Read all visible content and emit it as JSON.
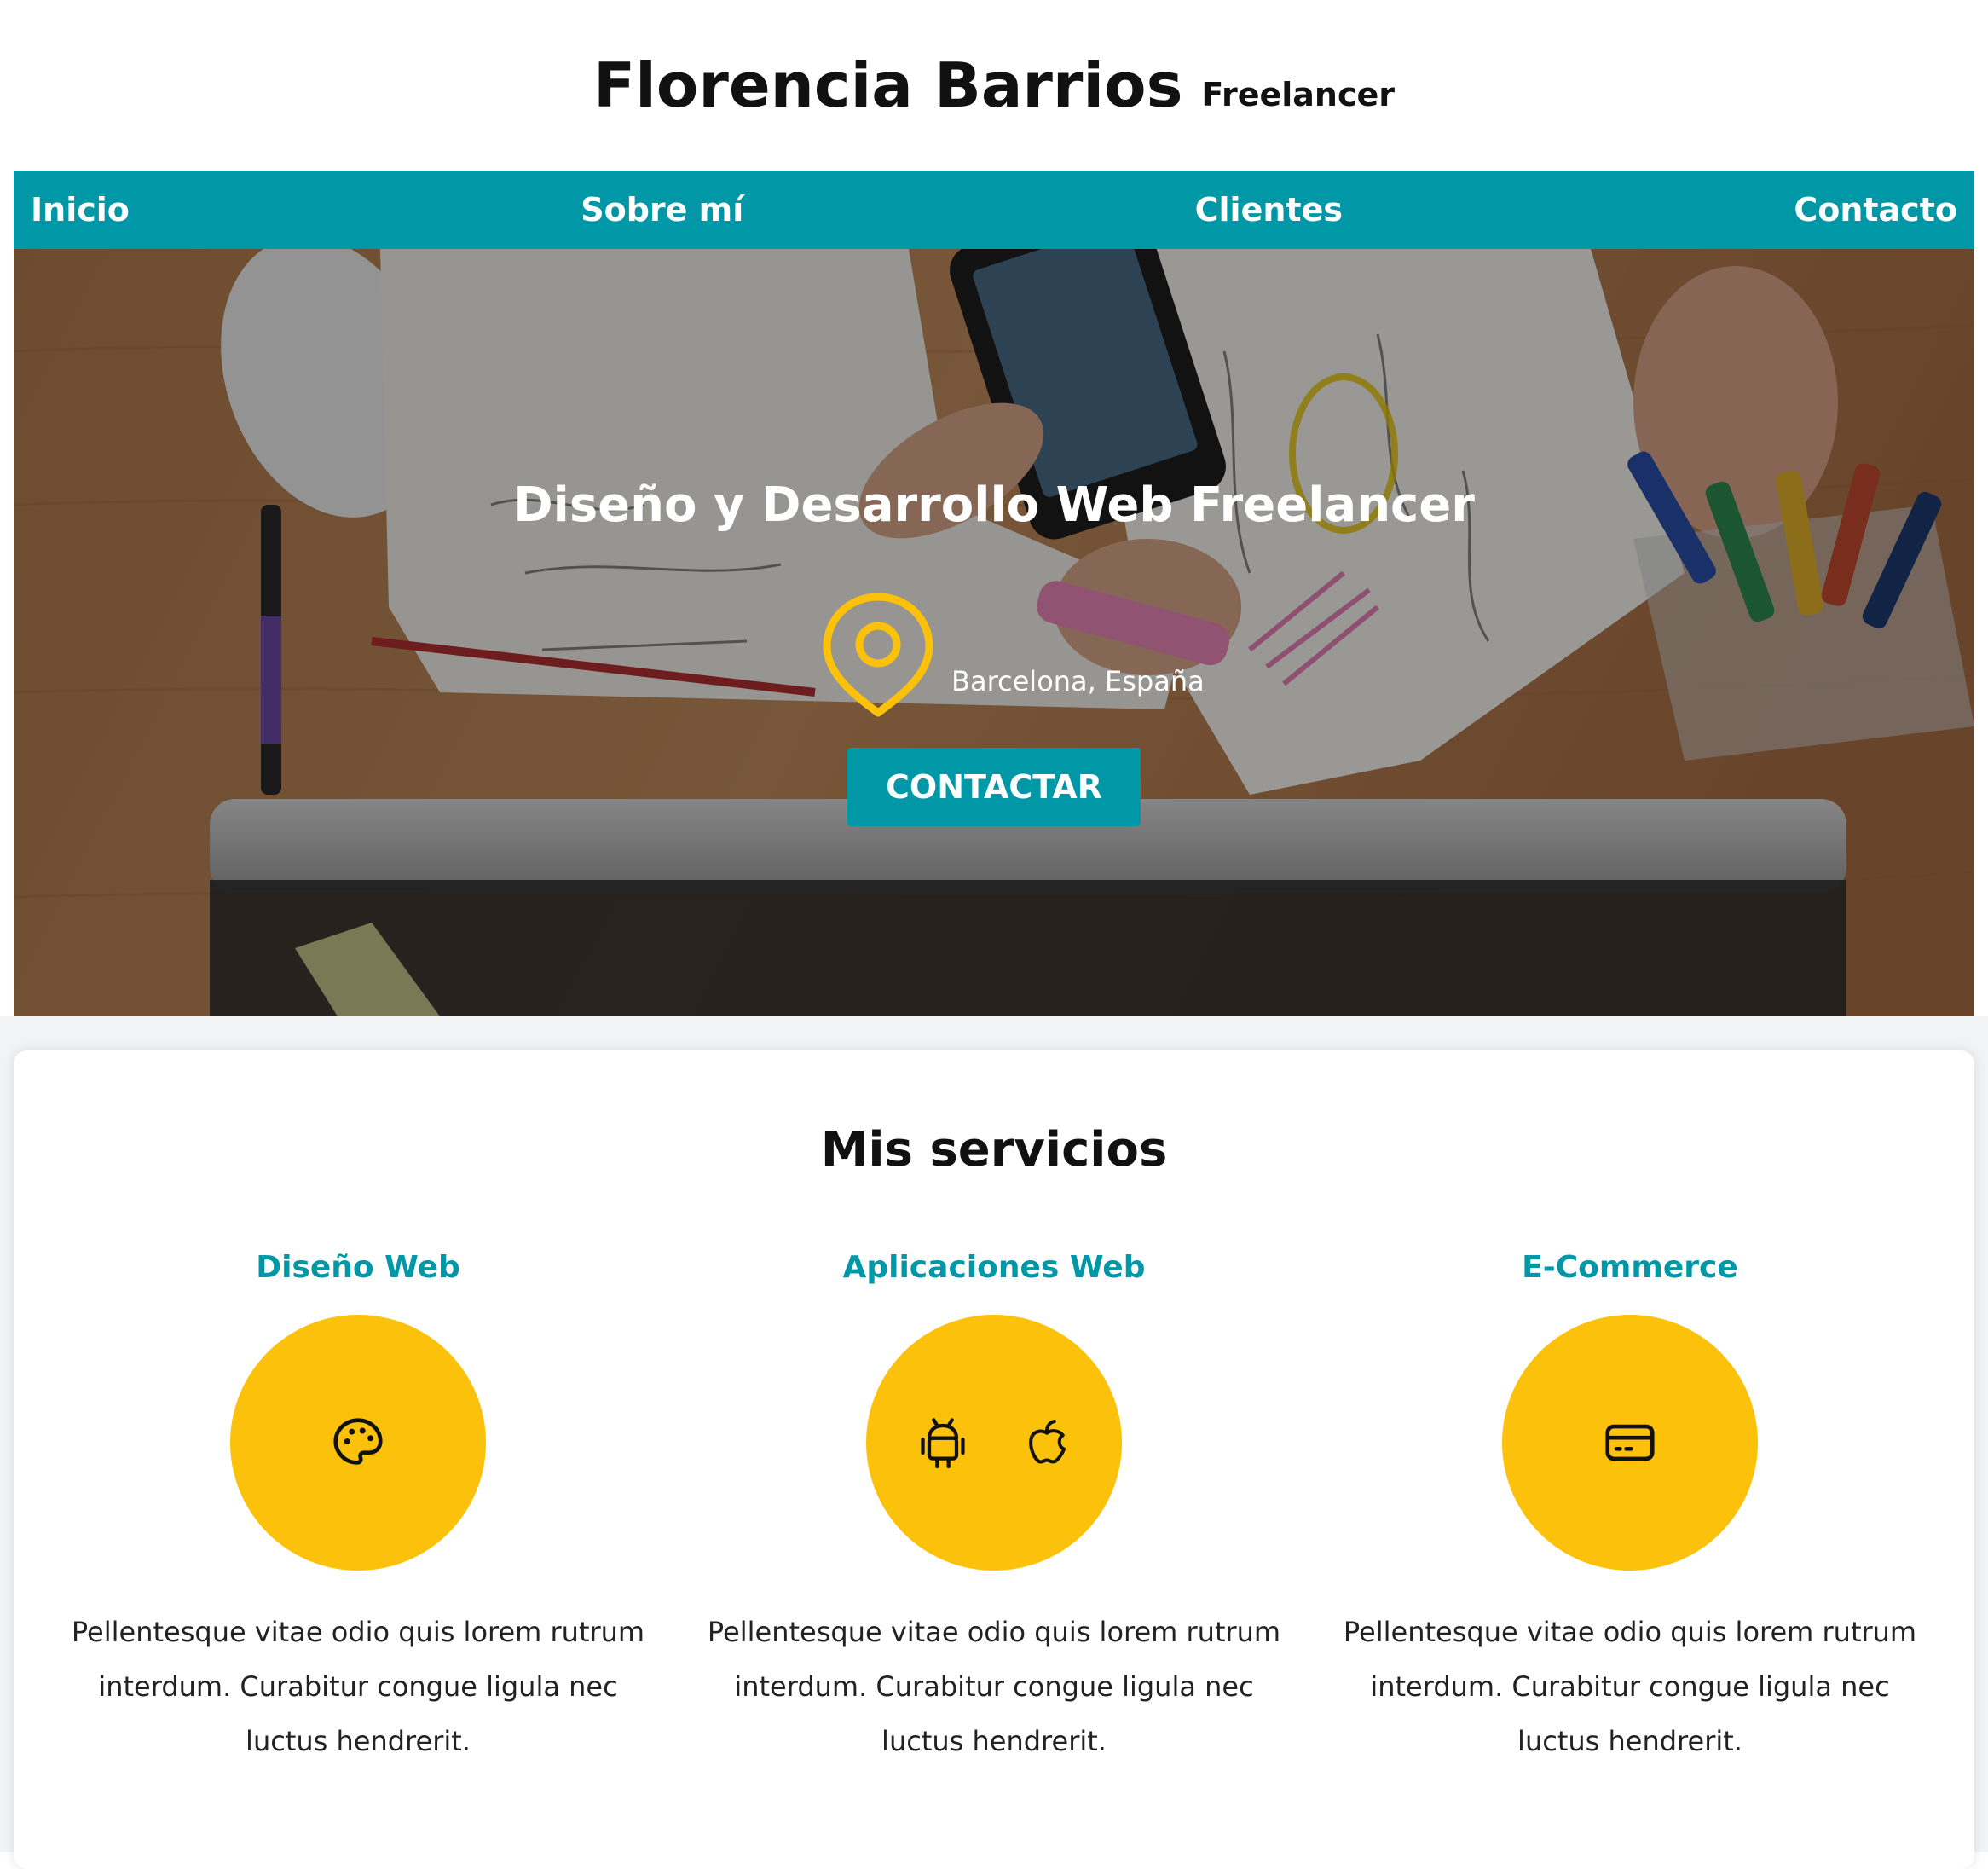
{
  "header": {
    "title": "Florencia Barrios",
    "subtitle": "Freelancer"
  },
  "nav": {
    "items": [
      {
        "label": "Inicio"
      },
      {
        "label": "Sobre mí"
      },
      {
        "label": "Clientes"
      },
      {
        "label": "Contacto"
      }
    ]
  },
  "hero": {
    "heading": "Diseño y Desarrollo Web Freelancer",
    "location": "Barcelona, España",
    "location_icon": "map-pin-icon",
    "button_label": "CONTACTAR"
  },
  "services": {
    "title": "Mis servicios",
    "items": [
      {
        "name": "Diseño Web",
        "icons": [
          "palette-icon"
        ],
        "description": "Pellentesque vitae odio quis lorem rutrum interdum. Curabitur congue ligula nec luctus hendrerit."
      },
      {
        "name": "Aplicaciones Web",
        "icons": [
          "android-icon",
          "apple-icon"
        ],
        "description": "Pellentesque vitae odio quis lorem rutrum interdum. Curabitur congue ligula nec luctus hendrerit."
      },
      {
        "name": "E-Commerce",
        "icons": [
          "credit-card-icon"
        ],
        "description": "Pellentesque vitae odio quis lorem rutrum interdum. Curabitur congue ligula nec luctus hendrerit."
      }
    ]
  },
  "colors": {
    "primary": "#0097a7",
    "accent": "#fcc10b",
    "text": "#111111"
  }
}
